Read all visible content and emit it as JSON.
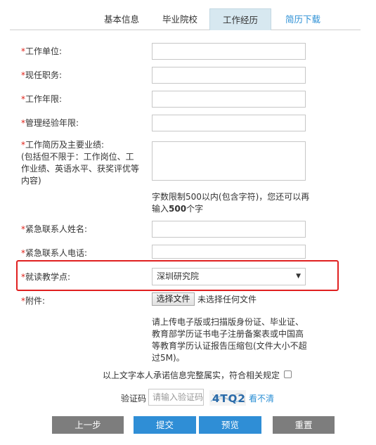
{
  "tabs": [
    {
      "label": "基本信息"
    },
    {
      "label": "毕业院校"
    },
    {
      "label": "工作经历"
    },
    {
      "label": "简历下载"
    }
  ],
  "form": {
    "required_mark": "*",
    "work_unit_label": "工作单位:",
    "position_label": "现任职务:",
    "years_label": "工作年限:",
    "mgmt_years_label": "管理经验年限:",
    "resume_label_line1": "工作简历及主要业绩:",
    "resume_label_line2": "(包括但不限于：工作岗位、工",
    "resume_label_line3": "作业绩、英语水平、获奖评优等",
    "resume_label_line4": "内容)",
    "char_limit_line1": "字数限制500以内(包含字符)，您还可以再",
    "char_limit_prefix": "输入",
    "char_limit_count": "500",
    "char_limit_suffix": "个字",
    "emergency_name_label": "紧急联系人姓名:",
    "emergency_phone_label": "紧急联系人电话:",
    "study_site_label": "就读教学点:",
    "study_site_value": "深圳研究院",
    "attachment_label": "附件:",
    "file_button": "选择文件",
    "file_status": "未选择任何文件",
    "attachment_note_line1": "请上传电子版或扫描版身份证、毕业证、",
    "attachment_note_line2": "教育部学历证书电子注册备案表或中国高",
    "attachment_note_line3": "等教育学历认证报告压缩包(文件大小不超",
    "attachment_note_line4": "过5M)。",
    "promise_text": "以上文字本人承诺信息完整属实，符合相关规定",
    "captcha_label": "验证码",
    "captcha_placeholder": "请输入验证码",
    "captcha_text": "4TQ2",
    "refresh_link": "看不清"
  },
  "buttons": {
    "prev": "上一步",
    "submit": "提交",
    "preview": "预览",
    "reset": "重置"
  },
  "colors": {
    "accent": "#2f8ed6",
    "required": "#e0241b",
    "highlight": "#e02020",
    "gray_button": "#7d7d7d",
    "active_tab": "#d7e8f0"
  }
}
